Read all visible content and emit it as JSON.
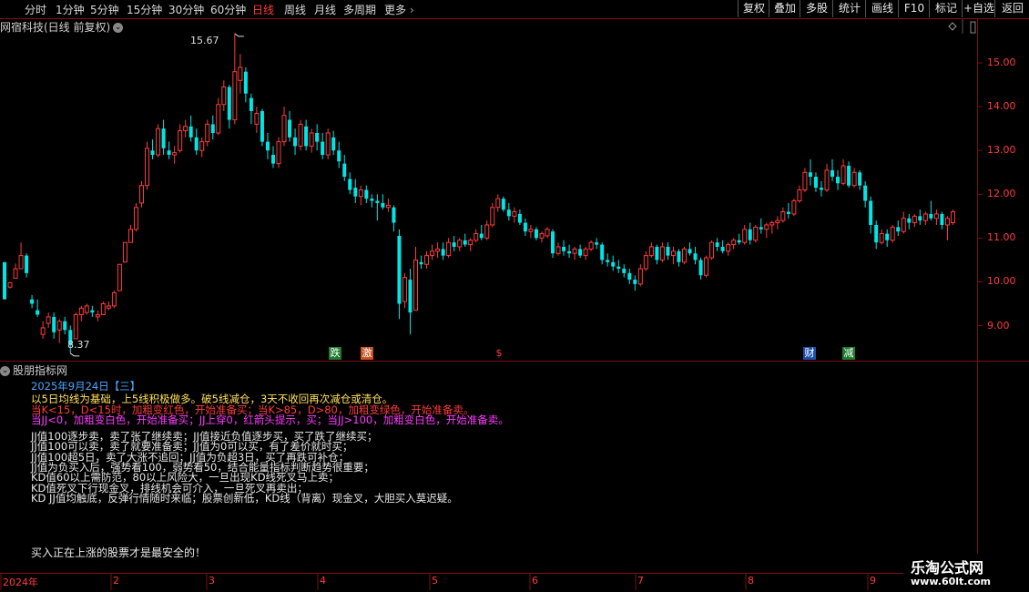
{
  "toolbar": {
    "timeframes": [
      {
        "label": "分时",
        "active": false
      },
      {
        "label": "1分钟",
        "active": false
      },
      {
        "label": "5分钟",
        "active": false
      },
      {
        "label": "15分钟",
        "active": false
      },
      {
        "label": "30分钟",
        "active": false
      },
      {
        "label": "60分钟",
        "active": false
      },
      {
        "label": "日线",
        "active": true
      },
      {
        "label": "周线",
        "active": false
      },
      {
        "label": "月线",
        "active": false
      },
      {
        "label": "多周期",
        "active": false
      }
    ],
    "more_label": "更多",
    "more_icon": "chevron-right-icon",
    "right_buttons": [
      "复权",
      "叠加",
      "多股",
      "统计",
      "画线",
      "F10",
      "标记",
      "+自选",
      "返回"
    ]
  },
  "chart": {
    "title": "网宿科技(日线 前复权)",
    "title_icon": "chevron-down-icon",
    "price_axis": [
      "15.00",
      "14.00",
      "13.00",
      "12.00",
      "11.00",
      "10.00",
      "9.00"
    ],
    "high_label": "15.67",
    "low_label": "8.37",
    "signals": [
      {
        "text": "跌",
        "color": "#1e7a2e"
      },
      {
        "text": "激",
        "color": "#c8501e"
      },
      {
        "text": "$",
        "color": "#ff3b3b"
      },
      {
        "text": "财",
        "color": "#1e4fa8"
      },
      {
        "text": "减",
        "color": "#1e7a2e"
      }
    ],
    "months": [
      "2024年",
      "2",
      "3",
      "4",
      "5",
      "6",
      "7",
      "8",
      "9"
    ]
  },
  "indicator": {
    "title": "股朋指标网",
    "title_icon": "chevron-down-icon",
    "date_line": "2025年9月24日【三】",
    "line1": "以5日均线为基础，上5线积极做多。破5线减仓，3天不收回再次减仓或清仓。",
    "line2": "当K<15，D<15时，加粗变红色，开始准备买；当K>85，D>80，加粗变绿色，开始准备卖。",
    "line3": "当JJ<0，加粗变白色，开始准备买；JJ上穿0，红箭头提示，买；当JJ>100，加粗变白色，开始准备卖。",
    "tips": [
      "JJ值100逐步卖，卖了张了继续卖；JJ值接近负值逐步买，买了跌了继续买；",
      "JJ值100可以卖，卖了就要准备卖；JJ值为0可以买，有了差价就时买；",
      "JJ值100超5日，卖了大涨不追回；JJ值为负超3日，买了再跌可补仓；",
      "JJ值为负买入后，强势看100，弱势看50，结合能量指标判断趋势很重要；",
      "KD值60以上需防范，80以上风险大，一旦出现KD线死叉马上卖；",
      "KD值死叉下行现金叉，排线机会可介入，一旦死叉再卖出；",
      "KD JJ值均触底，反弹行情随时来临；股票创新低，KD线（背离）现金叉，大胆买入莫迟疑。"
    ],
    "footer": "买入正在上涨的股票才是最安全的！"
  },
  "watermark": {
    "title": "乐淘公式网",
    "url": "www.60lt.com"
  },
  "colors": {
    "up": "#ff3b3b",
    "down": "#00e5e5",
    "border": "#7a1010"
  },
  "chart_data": {
    "type": "candlestick",
    "title": "网宿科技(日线 前复权)",
    "ylim": [
      8.2,
      16.0
    ],
    "y_ticks": [
      9,
      10,
      11,
      12,
      13,
      14,
      15
    ],
    "x_labels": [
      "2024年",
      "2",
      "3",
      "4",
      "5",
      "6",
      "7",
      "8",
      "9"
    ],
    "candles": [
      [
        10.45,
        10.45,
        10.0,
        9.6
      ],
      [
        9.88,
        10.0,
        9.85,
        9.98
      ],
      [
        10.08,
        10.42,
        10.08,
        10.3
      ],
      [
        10.3,
        10.9,
        10.3,
        10.6
      ],
      [
        10.6,
        10.65,
        10.1,
        10.2
      ],
      [
        9.6,
        9.7,
        9.4,
        9.5
      ],
      [
        9.35,
        9.6,
        9.2,
        9.25
      ],
      [
        8.8,
        9.1,
        8.7,
        8.95
      ],
      [
        9.05,
        9.3,
        8.95,
        9.2
      ],
      [
        9.2,
        9.3,
        8.7,
        8.85
      ],
      [
        8.9,
        9.15,
        8.6,
        9.1
      ],
      [
        9.1,
        9.2,
        8.8,
        8.9
      ],
      [
        8.9,
        9.0,
        8.37,
        8.55
      ],
      [
        8.7,
        9.3,
        8.7,
        9.25
      ],
      [
        9.25,
        9.45,
        9.1,
        9.4
      ],
      [
        9.3,
        9.5,
        9.25,
        9.45
      ],
      [
        9.35,
        9.45,
        9.2,
        9.3
      ],
      [
        9.2,
        9.35,
        9.1,
        9.25
      ],
      [
        9.25,
        9.55,
        9.25,
        9.5
      ],
      [
        9.4,
        9.55,
        9.35,
        9.45
      ],
      [
        9.45,
        9.8,
        9.4,
        9.75
      ],
      [
        9.8,
        10.4,
        9.8,
        10.4
      ],
      [
        10.45,
        10.9,
        10.45,
        10.9
      ],
      [
        10.9,
        11.3,
        10.9,
        11.2
      ],
      [
        11.2,
        11.8,
        11.15,
        11.7
      ],
      [
        11.8,
        12.3,
        11.7,
        12.2
      ],
      [
        12.2,
        13.2,
        12.1,
        13.05
      ],
      [
        13.0,
        13.25,
        12.8,
        12.9
      ],
      [
        12.9,
        13.6,
        12.85,
        13.5
      ],
      [
        13.5,
        13.7,
        12.9,
        13.05
      ],
      [
        13.0,
        13.2,
        12.8,
        12.9
      ],
      [
        12.9,
        13.1,
        12.7,
        12.95
      ],
      [
        13.0,
        13.6,
        12.95,
        13.45
      ],
      [
        13.45,
        13.7,
        13.3,
        13.55
      ],
      [
        13.55,
        13.8,
        13.2,
        13.3
      ],
      [
        13.3,
        13.5,
        12.9,
        13.0
      ],
      [
        13.0,
        13.3,
        12.85,
        13.2
      ],
      [
        13.2,
        13.7,
        13.1,
        13.6
      ],
      [
        13.6,
        13.8,
        13.25,
        13.4
      ],
      [
        13.4,
        14.2,
        13.35,
        14.05
      ],
      [
        14.05,
        14.6,
        13.9,
        14.45
      ],
      [
        14.45,
        14.5,
        13.5,
        13.7
      ],
      [
        13.7,
        15.67,
        13.6,
        14.8
      ],
      [
        14.6,
        15.2,
        14.3,
        14.9
      ],
      [
        14.8,
        14.9,
        14.1,
        14.3
      ],
      [
        14.2,
        14.3,
        13.6,
        13.9
      ],
      [
        13.6,
        14.0,
        13.4,
        13.85
      ],
      [
        13.9,
        13.95,
        13.1,
        13.2
      ],
      [
        13.2,
        13.4,
        12.8,
        13.0
      ],
      [
        12.9,
        13.1,
        12.6,
        12.7
      ],
      [
        12.7,
        13.3,
        12.6,
        13.2
      ],
      [
        13.2,
        14.0,
        13.1,
        13.8
      ],
      [
        13.7,
        13.9,
        13.2,
        13.3
      ],
      [
        13.3,
        13.5,
        12.9,
        13.1
      ],
      [
        13.1,
        13.7,
        13.0,
        13.6
      ],
      [
        13.55,
        13.7,
        13.0,
        13.1
      ],
      [
        13.1,
        13.5,
        12.95,
        13.4
      ],
      [
        13.4,
        13.6,
        13.0,
        13.2
      ],
      [
        13.2,
        13.4,
        12.8,
        12.9
      ],
      [
        12.9,
        13.5,
        12.8,
        13.4
      ],
      [
        13.3,
        13.45,
        12.9,
        13.0
      ],
      [
        13.0,
        13.2,
        12.6,
        12.75
      ],
      [
        12.7,
        12.9,
        12.3,
        12.4
      ],
      [
        12.35,
        12.5,
        12.0,
        12.1
      ],
      [
        12.15,
        12.35,
        11.8,
        11.95
      ],
      [
        11.95,
        12.2,
        11.75,
        12.1
      ],
      [
        12.1,
        12.2,
        11.8,
        11.9
      ],
      [
        11.9,
        12.0,
        11.7,
        11.85
      ],
      [
        11.85,
        12.0,
        11.4,
        11.8
      ],
      [
        11.8,
        12.0,
        11.65,
        11.7
      ],
      [
        11.7,
        11.9,
        11.6,
        11.75
      ],
      [
        11.7,
        11.75,
        11.15,
        11.35
      ],
      [
        11.05,
        11.2,
        9.15,
        9.5
      ],
      [
        9.55,
        10.2,
        9.4,
        10.1
      ],
      [
        10.05,
        10.3,
        8.8,
        9.3
      ],
      [
        9.35,
        10.8,
        9.35,
        10.5
      ],
      [
        10.45,
        10.6,
        10.3,
        10.4
      ],
      [
        10.4,
        10.7,
        10.3,
        10.6
      ],
      [
        10.6,
        10.85,
        10.5,
        10.7
      ],
      [
        10.7,
        10.9,
        10.55,
        10.75
      ],
      [
        10.75,
        10.9,
        10.5,
        10.6
      ],
      [
        10.6,
        11.0,
        10.55,
        10.9
      ],
      [
        10.9,
        11.05,
        10.7,
        10.8
      ],
      [
        10.8,
        11.0,
        10.7,
        10.95
      ],
      [
        10.95,
        11.1,
        10.8,
        10.85
      ],
      [
        10.85,
        11.0,
        10.7,
        10.95
      ],
      [
        10.95,
        11.2,
        10.9,
        11.1
      ],
      [
        11.1,
        11.3,
        10.95,
        11.0
      ],
      [
        11.0,
        11.4,
        10.95,
        11.3
      ],
      [
        11.3,
        11.8,
        11.25,
        11.7
      ],
      [
        11.7,
        12.0,
        11.6,
        11.9
      ],
      [
        11.9,
        11.95,
        11.6,
        11.65
      ],
      [
        11.65,
        11.8,
        11.4,
        11.5
      ],
      [
        11.5,
        11.7,
        11.35,
        11.6
      ],
      [
        11.55,
        11.65,
        11.3,
        11.35
      ],
      [
        11.35,
        11.45,
        11.05,
        11.15
      ],
      [
        11.15,
        11.3,
        11.0,
        11.2
      ],
      [
        11.2,
        11.25,
        10.95,
        11.0
      ],
      [
        11.0,
        11.15,
        10.9,
        11.1
      ],
      [
        11.05,
        11.25,
        11.0,
        11.2
      ],
      [
        11.15,
        11.2,
        10.55,
        10.65
      ],
      [
        10.65,
        10.9,
        10.6,
        10.8
      ],
      [
        10.8,
        10.95,
        10.6,
        10.7
      ],
      [
        10.7,
        10.85,
        10.55,
        10.65
      ],
      [
        10.65,
        10.8,
        10.5,
        10.75
      ],
      [
        10.75,
        10.85,
        10.55,
        10.6
      ],
      [
        10.6,
        10.8,
        10.5,
        10.75
      ],
      [
        10.75,
        10.95,
        10.7,
        10.9
      ],
      [
        10.9,
        11.0,
        10.75,
        10.85
      ],
      [
        10.85,
        10.9,
        10.4,
        10.5
      ],
      [
        10.5,
        10.65,
        10.35,
        10.45
      ],
      [
        10.45,
        10.6,
        10.25,
        10.35
      ],
      [
        10.35,
        10.5,
        10.2,
        10.3
      ],
      [
        10.3,
        10.4,
        10.1,
        10.2
      ],
      [
        10.2,
        10.3,
        9.95,
        10.05
      ],
      [
        10.05,
        10.15,
        9.8,
        9.95
      ],
      [
        9.95,
        10.4,
        9.9,
        10.3
      ],
      [
        10.3,
        10.7,
        10.25,
        10.6
      ],
      [
        10.6,
        10.9,
        10.55,
        10.8
      ],
      [
        10.8,
        10.85,
        10.4,
        10.5
      ],
      [
        10.5,
        10.9,
        10.45,
        10.8
      ],
      [
        10.8,
        10.9,
        10.5,
        10.6
      ],
      [
        10.6,
        10.8,
        10.4,
        10.7
      ],
      [
        10.7,
        10.75,
        10.35,
        10.45
      ],
      [
        10.45,
        10.8,
        10.4,
        10.75
      ],
      [
        10.75,
        10.9,
        10.6,
        10.65
      ],
      [
        10.65,
        10.8,
        10.4,
        10.5
      ],
      [
        10.5,
        10.55,
        10.05,
        10.15
      ],
      [
        10.15,
        10.6,
        10.1,
        10.55
      ],
      [
        10.55,
        10.95,
        10.5,
        10.9
      ],
      [
        10.9,
        11.0,
        10.7,
        10.8
      ],
      [
        10.8,
        10.95,
        10.65,
        10.7
      ],
      [
        10.7,
        10.9,
        10.6,
        10.85
      ],
      [
        10.85,
        11.0,
        10.75,
        10.95
      ],
      [
        10.95,
        11.1,
        10.85,
        10.9
      ],
      [
        10.9,
        11.3,
        10.85,
        11.2
      ],
      [
        11.2,
        11.35,
        10.85,
        10.95
      ],
      [
        10.95,
        11.3,
        10.9,
        11.25
      ],
      [
        11.25,
        11.45,
        11.1,
        11.2
      ],
      [
        11.2,
        11.35,
        11.0,
        11.3
      ],
      [
        11.3,
        11.4,
        11.1,
        11.35
      ],
      [
        11.35,
        11.5,
        11.2,
        11.4
      ],
      [
        11.4,
        11.7,
        11.35,
        11.6
      ],
      [
        11.6,
        11.8,
        11.45,
        11.55
      ],
      [
        11.55,
        11.9,
        11.5,
        11.85
      ],
      [
        11.85,
        12.2,
        11.8,
        12.1
      ],
      [
        12.1,
        12.6,
        12.05,
        12.5
      ],
      [
        12.5,
        12.8,
        12.2,
        12.4
      ],
      [
        12.4,
        12.5,
        12.05,
        12.15
      ],
      [
        12.15,
        12.3,
        11.95,
        12.1
      ],
      [
        12.1,
        12.7,
        12.05,
        12.55
      ],
      [
        12.55,
        12.8,
        12.3,
        12.4
      ],
      [
        12.4,
        12.55,
        12.1,
        12.25
      ],
      [
        12.25,
        12.8,
        12.2,
        12.65
      ],
      [
        12.65,
        12.75,
        12.15,
        12.2
      ],
      [
        12.2,
        12.6,
        12.15,
        12.5
      ],
      [
        12.5,
        12.55,
        12.1,
        12.2
      ],
      [
        12.2,
        12.3,
        11.7,
        11.85
      ],
      [
        11.85,
        11.95,
        11.1,
        11.3
      ],
      [
        11.3,
        11.4,
        10.75,
        10.9
      ],
      [
        10.9,
        11.2,
        10.85,
        11.1
      ],
      [
        11.1,
        11.2,
        10.8,
        10.95
      ],
      [
        10.95,
        11.3,
        10.9,
        11.25
      ],
      [
        11.25,
        11.4,
        11.05,
        11.15
      ],
      [
        11.15,
        11.6,
        11.1,
        11.45
      ],
      [
        11.45,
        11.55,
        11.2,
        11.35
      ],
      [
        11.35,
        11.55,
        11.25,
        11.5
      ],
      [
        11.5,
        11.65,
        11.3,
        11.4
      ],
      [
        11.4,
        11.6,
        11.3,
        11.55
      ],
      [
        11.55,
        11.85,
        11.4,
        11.45
      ],
      [
        11.45,
        11.65,
        11.3,
        11.55
      ],
      [
        11.55,
        11.6,
        11.2,
        11.3
      ],
      [
        11.3,
        11.5,
        10.95,
        11.45
      ],
      [
        11.35,
        11.65,
        11.3,
        11.6
      ]
    ]
  }
}
